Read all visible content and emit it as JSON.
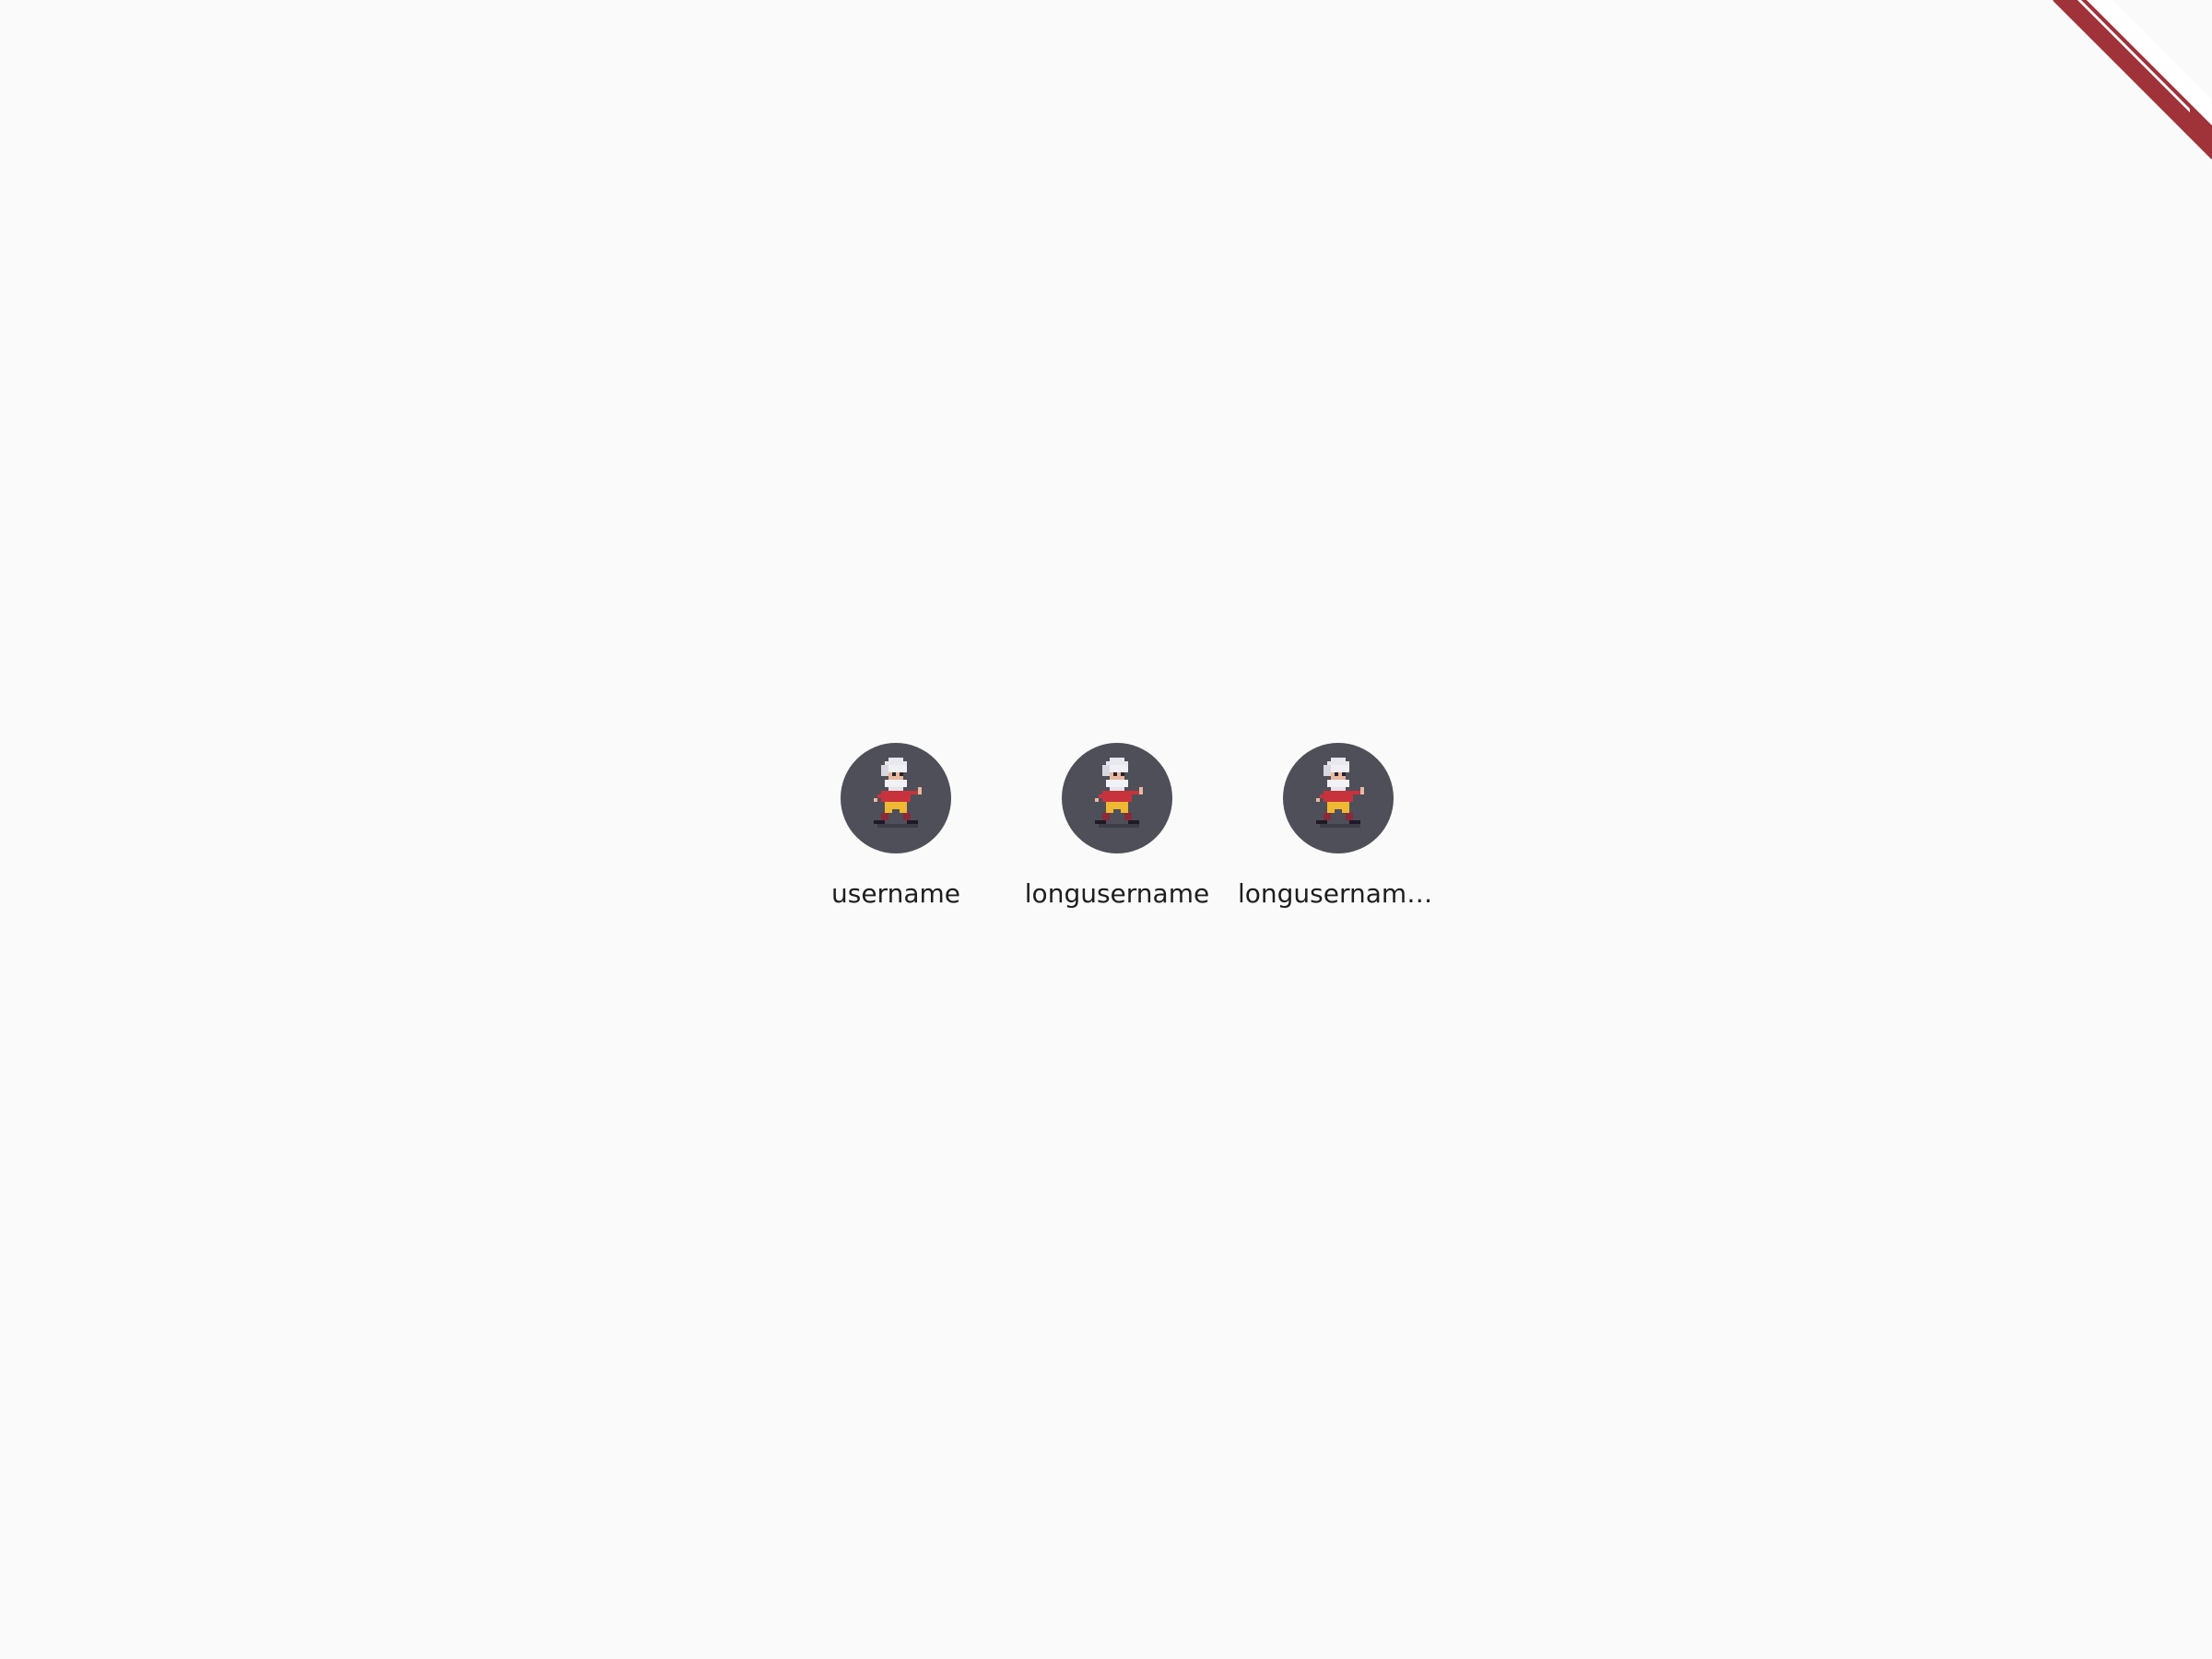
{
  "avatars": [
    {
      "name": "username"
    },
    {
      "name": "longusername"
    },
    {
      "name": "longusername..."
    }
  ],
  "colors": {
    "background": "#fafafa",
    "avatar_bg": "#4e4f58",
    "ribbon": "#a0333a",
    "text": "#1e1e1e"
  },
  "icons": {
    "avatar_sprite": "pixel-old-man-running-icon",
    "corner": "corner-ribbon"
  }
}
